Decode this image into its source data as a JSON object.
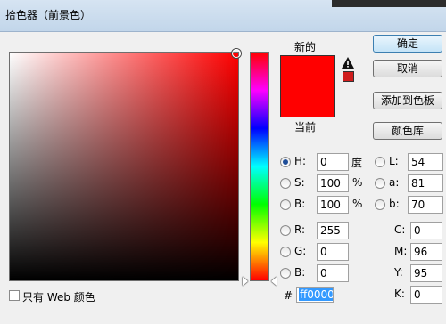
{
  "window": {
    "title": "拾色器（前景色）"
  },
  "preview": {
    "new_label": "新的",
    "current_label": "当前",
    "new_color": "#ff0000",
    "current_color": "#ff0000",
    "gamut_warning_symbol": "▲!",
    "gamut_color": "#d01e1e"
  },
  "buttons": {
    "ok": "确定",
    "cancel": "取消",
    "add_to_swatches": "添加到色板",
    "color_libraries": "颜色库"
  },
  "hsb": {
    "h": {
      "label": "H:",
      "value": "0",
      "unit": "度",
      "selected": true
    },
    "s": {
      "label": "S:",
      "value": "100",
      "unit": "%"
    },
    "b": {
      "label": "B:",
      "value": "100",
      "unit": "%"
    }
  },
  "rgb": {
    "r": {
      "label": "R:",
      "value": "255"
    },
    "g": {
      "label": "G:",
      "value": "0"
    },
    "b": {
      "label": "B:",
      "value": "0"
    }
  },
  "lab": {
    "l": {
      "label": "L:",
      "value": "54"
    },
    "a": {
      "label": "a:",
      "value": "81"
    },
    "b": {
      "label": "b:",
      "value": "70"
    }
  },
  "cmyk": {
    "c": {
      "label": "C:",
      "value": "0"
    },
    "m": {
      "label": "M:",
      "value": "96"
    },
    "y": {
      "label": "Y:",
      "value": "95"
    },
    "k": {
      "label": "K:",
      "value": "0"
    }
  },
  "bottom": {
    "web_only_label": "只有 Web 颜色",
    "hash": "#",
    "hex_value": "ff0000"
  }
}
